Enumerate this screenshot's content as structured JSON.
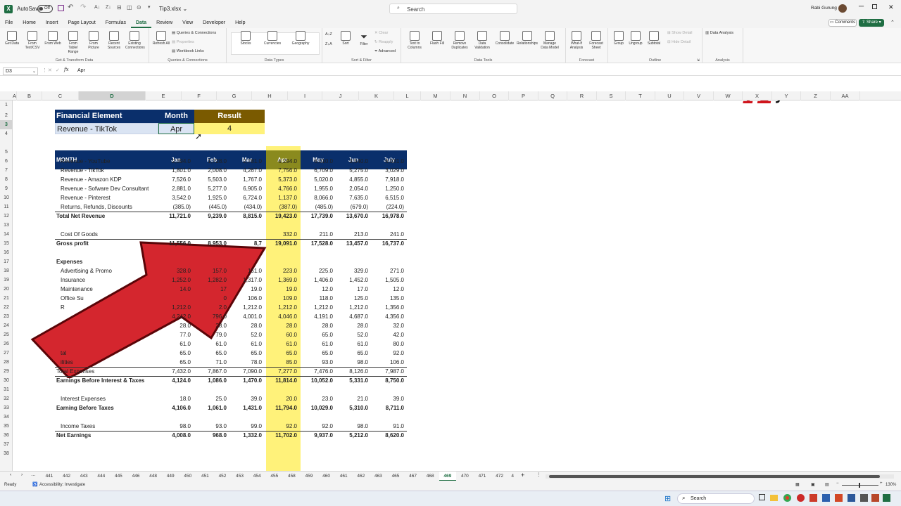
{
  "titlebar": {
    "autosave_label": "AutoSave",
    "autosave_state": "Off",
    "filename": "Tip3.xlsx",
    "search_placeholder": "Search",
    "user_name": "Rabi Gurung"
  },
  "menu": {
    "tabs": [
      "File",
      "Home",
      "Insert",
      "Page Layout",
      "Formulas",
      "Data",
      "Review",
      "View",
      "Developer",
      "Help"
    ],
    "active": "Data",
    "comments_label": "Comments",
    "share_label": "Share"
  },
  "ribbon": {
    "get_transform": {
      "buttons": [
        "Get Data",
        "From Text/CSV",
        "From Web",
        "From Table/ Range",
        "From Picture",
        "Recent Sources",
        "Existing Connections"
      ],
      "name": "Get & Transform Data"
    },
    "queries": {
      "refresh": "Refresh All",
      "items": [
        "Queries & Connections",
        "Properties",
        "Workbook Links"
      ],
      "name": "Queries & Connections"
    },
    "data_types": {
      "items": [
        "Stocks",
        "Currencies",
        "Geography"
      ],
      "name": "Data Types"
    },
    "sort_filter": {
      "sort": "Sort",
      "filter": "Filter",
      "small": [
        "Clear",
        "Reapply",
        "Advanced"
      ],
      "name": "Sort & Filter"
    },
    "data_tools": {
      "items": [
        "Text to Columns",
        "Flash Fill",
        "Remove Duplicates",
        "Data Validation",
        "Consolidate",
        "Relationships",
        "Manage Data Model"
      ],
      "name": "Data Tools"
    },
    "forecast": {
      "items": [
        "What-If Analysis",
        "Forecast Sheet"
      ],
      "name": "Forecast"
    },
    "outline": {
      "items": [
        "Group",
        "Ungroup",
        "Subtotal"
      ],
      "small": [
        "Show Detail",
        "Hide Detail"
      ],
      "name": "Outline"
    },
    "analysis": {
      "item": "Data Analysis",
      "name": "Analysis"
    }
  },
  "formula_bar": {
    "name_box": "D3",
    "formula": "Apr"
  },
  "columns": [
    "A",
    "B",
    "C",
    "D",
    "E",
    "F",
    "G",
    "H",
    "I",
    "J",
    "K",
    "L",
    "M",
    "N",
    "O",
    "P",
    "Q",
    "R",
    "S",
    "T",
    "U",
    "V",
    "W",
    "X",
    "Y",
    "Z",
    "AA"
  ],
  "rows": [
    "1",
    "2",
    "3",
    "4",
    "5",
    "6",
    "7",
    "8",
    "9",
    "10",
    "11",
    "12",
    "13",
    "14",
    "15",
    "16",
    "17",
    "18",
    "19",
    "20",
    "21",
    "22",
    "23",
    "24",
    "25",
    "26",
    "27",
    "28",
    "29",
    "30",
    "31",
    "32",
    "33",
    "34",
    "35",
    "36",
    "37",
    "38"
  ],
  "lookup": {
    "headers": [
      "Financial Element",
      "Month",
      "Result"
    ],
    "element": "Revenue - TikTok",
    "month": "Apr",
    "result": "4"
  },
  "table": {
    "month_header": "MONTH",
    "months": [
      "Jan",
      "Feb",
      "Mar",
      "Apr",
      "May",
      "Jun",
      "July"
    ],
    "rows": [
      {
        "r": 6,
        "label": "Revenue - YouTube",
        "indent": true,
        "values": [
          "2,394.0",
          "1,728.0",
          "2,781.0",
          "6,294.0",
          "6,010.0",
          "3,540.0",
          "6,031.0"
        ]
      },
      {
        "r": 7,
        "label": "Revenue - TikTok",
        "indent": true,
        "values": [
          "1,801.0",
          "2,008.0",
          "4,267.0",
          "7,756.0",
          "6,709.0",
          "5,275.0",
          "3,029.0"
        ]
      },
      {
        "r": 8,
        "label": "Revenue - Amazon KDP",
        "indent": true,
        "values": [
          "7,526.0",
          "5,503.0",
          "1,767.0",
          "5,373.0",
          "5,020.0",
          "4,855.0",
          "7,918.0"
        ]
      },
      {
        "r": 9,
        "label": "Revenue - Sofware Dev Consultant",
        "indent": true,
        "values": [
          "2,881.0",
          "5,277.0",
          "6,905.0",
          "4,766.0",
          "1,955.0",
          "2,054.0",
          "1,250.0"
        ]
      },
      {
        "r": 10,
        "label": "Revenue - Pinterest",
        "indent": true,
        "values": [
          "3,542.0",
          "1,925.0",
          "6,724.0",
          "1,137.0",
          "8,066.0",
          "7,635.0",
          "6,515.0"
        ]
      },
      {
        "r": 11,
        "label": "Returns, Refunds, Discounts",
        "indent": true,
        "values": [
          "(385.0)",
          "(445.0)",
          "(434.0)",
          "(387.0)",
          "(485.0)",
          "(679.0)",
          "(224.0)"
        ]
      },
      {
        "r": 12,
        "label": "Total Net Revenue",
        "bold": true,
        "values": [
          "11,721.0",
          "9,239.0",
          "8,815.0",
          "19,423.0",
          "17,739.0",
          "13,670.0",
          "16,978.0"
        ]
      },
      {
        "r": 14,
        "label": "Cost Of Goods",
        "indent": true,
        "values": [
          "",
          "",
          "",
          "332.0",
          "211.0",
          "213.0",
          "241.0"
        ]
      },
      {
        "r": 15,
        "label": "Gross profit",
        "bold": true,
        "values": [
          "11,556.0",
          "8,953.0",
          "8,7",
          "19,091.0",
          "17,528.0",
          "13,457.0",
          "16,737.0"
        ]
      },
      {
        "r": 17,
        "label": "Expenses",
        "bold": true,
        "values": [
          "",
          "",
          "",
          "",
          "",
          "",
          ""
        ]
      },
      {
        "r": 18,
        "label": "Advertising & Promo",
        "indent": true,
        "values": [
          "328.0",
          "157.0",
          "151.0",
          "223.0",
          "225.0",
          "329.0",
          "271.0"
        ]
      },
      {
        "r": 19,
        "label": "Insurance",
        "indent": true,
        "values": [
          "1,252.0",
          "1,282.0",
          "1,317.0",
          "1,369.0",
          "1,406.0",
          "1,452.0",
          "1,505.0"
        ]
      },
      {
        "r": 20,
        "label": "Maintenance",
        "indent": true,
        "values": [
          "14.0",
          "17",
          "19.0",
          "19.0",
          "12.0",
          "17.0",
          "12.0"
        ]
      },
      {
        "r": 21,
        "label": "Office Su",
        "indent": true,
        "values": [
          "",
          "0",
          "106.0",
          "109.0",
          "118.0",
          "125.0",
          "135.0"
        ]
      },
      {
        "r": 22,
        "label": "R",
        "indent": true,
        "values": [
          "1,212.0",
          "2.0",
          "1,212.0",
          "1,212.0",
          "1,212.0",
          "1,212.0",
          "1,356.0"
        ]
      },
      {
        "r": 23,
        "label": "",
        "indent": true,
        "values": [
          "4,242.0",
          "796.0",
          "4,001.0",
          "4,046.0",
          "4,191.0",
          "4,687.0",
          "4,356.0"
        ]
      },
      {
        "r": 24,
        "label": "",
        "indent": true,
        "values": [
          "28.0",
          "28.0",
          "28.0",
          "28.0",
          "28.0",
          "28.0",
          "32.0"
        ]
      },
      {
        "r": 25,
        "label": "",
        "indent": true,
        "values": [
          "77.0",
          "79.0",
          "52.0",
          "60.0",
          "65.0",
          "52.0",
          "42.0"
        ]
      },
      {
        "r": 26,
        "label": "",
        "indent": true,
        "values": [
          "61.0",
          "61.0",
          "61.0",
          "61.0",
          "61.0",
          "61.0",
          "80.0"
        ]
      },
      {
        "r": 27,
        "label": "tal",
        "indent": true,
        "values": [
          "65.0",
          "65.0",
          "65.0",
          "65.0",
          "65.0",
          "65.0",
          "92.0"
        ]
      },
      {
        "r": 28,
        "label": "ilities",
        "indent": true,
        "values": [
          "65.0",
          "71.0",
          "78.0",
          "85.0",
          "93.0",
          "98.0",
          "106.0"
        ]
      },
      {
        "r": 29,
        "label": "Total Expenses",
        "values": [
          "7,432.0",
          "7,867.0",
          "7,090.0",
          "7,277.0",
          "7,476.0",
          "8,126.0",
          "7,987.0"
        ]
      },
      {
        "r": 30,
        "label": "Earnings Before Interest & Taxes",
        "bold": true,
        "values": [
          "4,124.0",
          "1,086.0",
          "1,470.0",
          "11,814.0",
          "10,052.0",
          "5,331.0",
          "8,750.0"
        ]
      },
      {
        "r": 32,
        "label": "Interest Expenses",
        "indent": true,
        "values": [
          "18.0",
          "25.0",
          "39.0",
          "20.0",
          "23.0",
          "21.0",
          "39.0"
        ]
      },
      {
        "r": 33,
        "label": "Earning Before Taxes",
        "bold": true,
        "values": [
          "4,106.0",
          "1,061.0",
          "1,431.0",
          "11,794.0",
          "10,029.0",
          "5,310.0",
          "8,711.0"
        ]
      },
      {
        "r": 35,
        "label": "Income Taxes",
        "indent": true,
        "values": [
          "98.0",
          "93.0",
          "99.0",
          "92.0",
          "92.0",
          "98.0",
          "91.0"
        ]
      },
      {
        "r": 36,
        "label": "Net Earnings",
        "bold": true,
        "values": [
          "4,008.0",
          "968.0",
          "1,332.0",
          "11,702.0",
          "9,937.0",
          "5,212.0",
          "8,620.0"
        ]
      }
    ]
  },
  "logo": {
    "text": "ybernetics"
  },
  "sheet_tabs": [
    "441",
    "442",
    "443",
    "444",
    "445",
    "446",
    "448",
    "449",
    "450",
    "451",
    "452",
    "453",
    "454",
    "455",
    "458",
    "459",
    "460",
    "461",
    "462",
    "463",
    "465",
    "467",
    "468",
    "469",
    "470",
    "471",
    "472",
    "4"
  ],
  "active_sheet": "469",
  "status": {
    "ready": "Ready",
    "accessibility": "Accessibility: Investigate",
    "zoom": "130%"
  },
  "taskbar": {
    "search": "Search"
  },
  "colors": {
    "excel_green": "#1f6e43",
    "header_navy": "#0a2f6b",
    "result_brown": "#7a5a00",
    "highlight_yellow": "#fff27a",
    "highlight_header": "#8a8a1e",
    "arrow_red": "#d0141c"
  }
}
